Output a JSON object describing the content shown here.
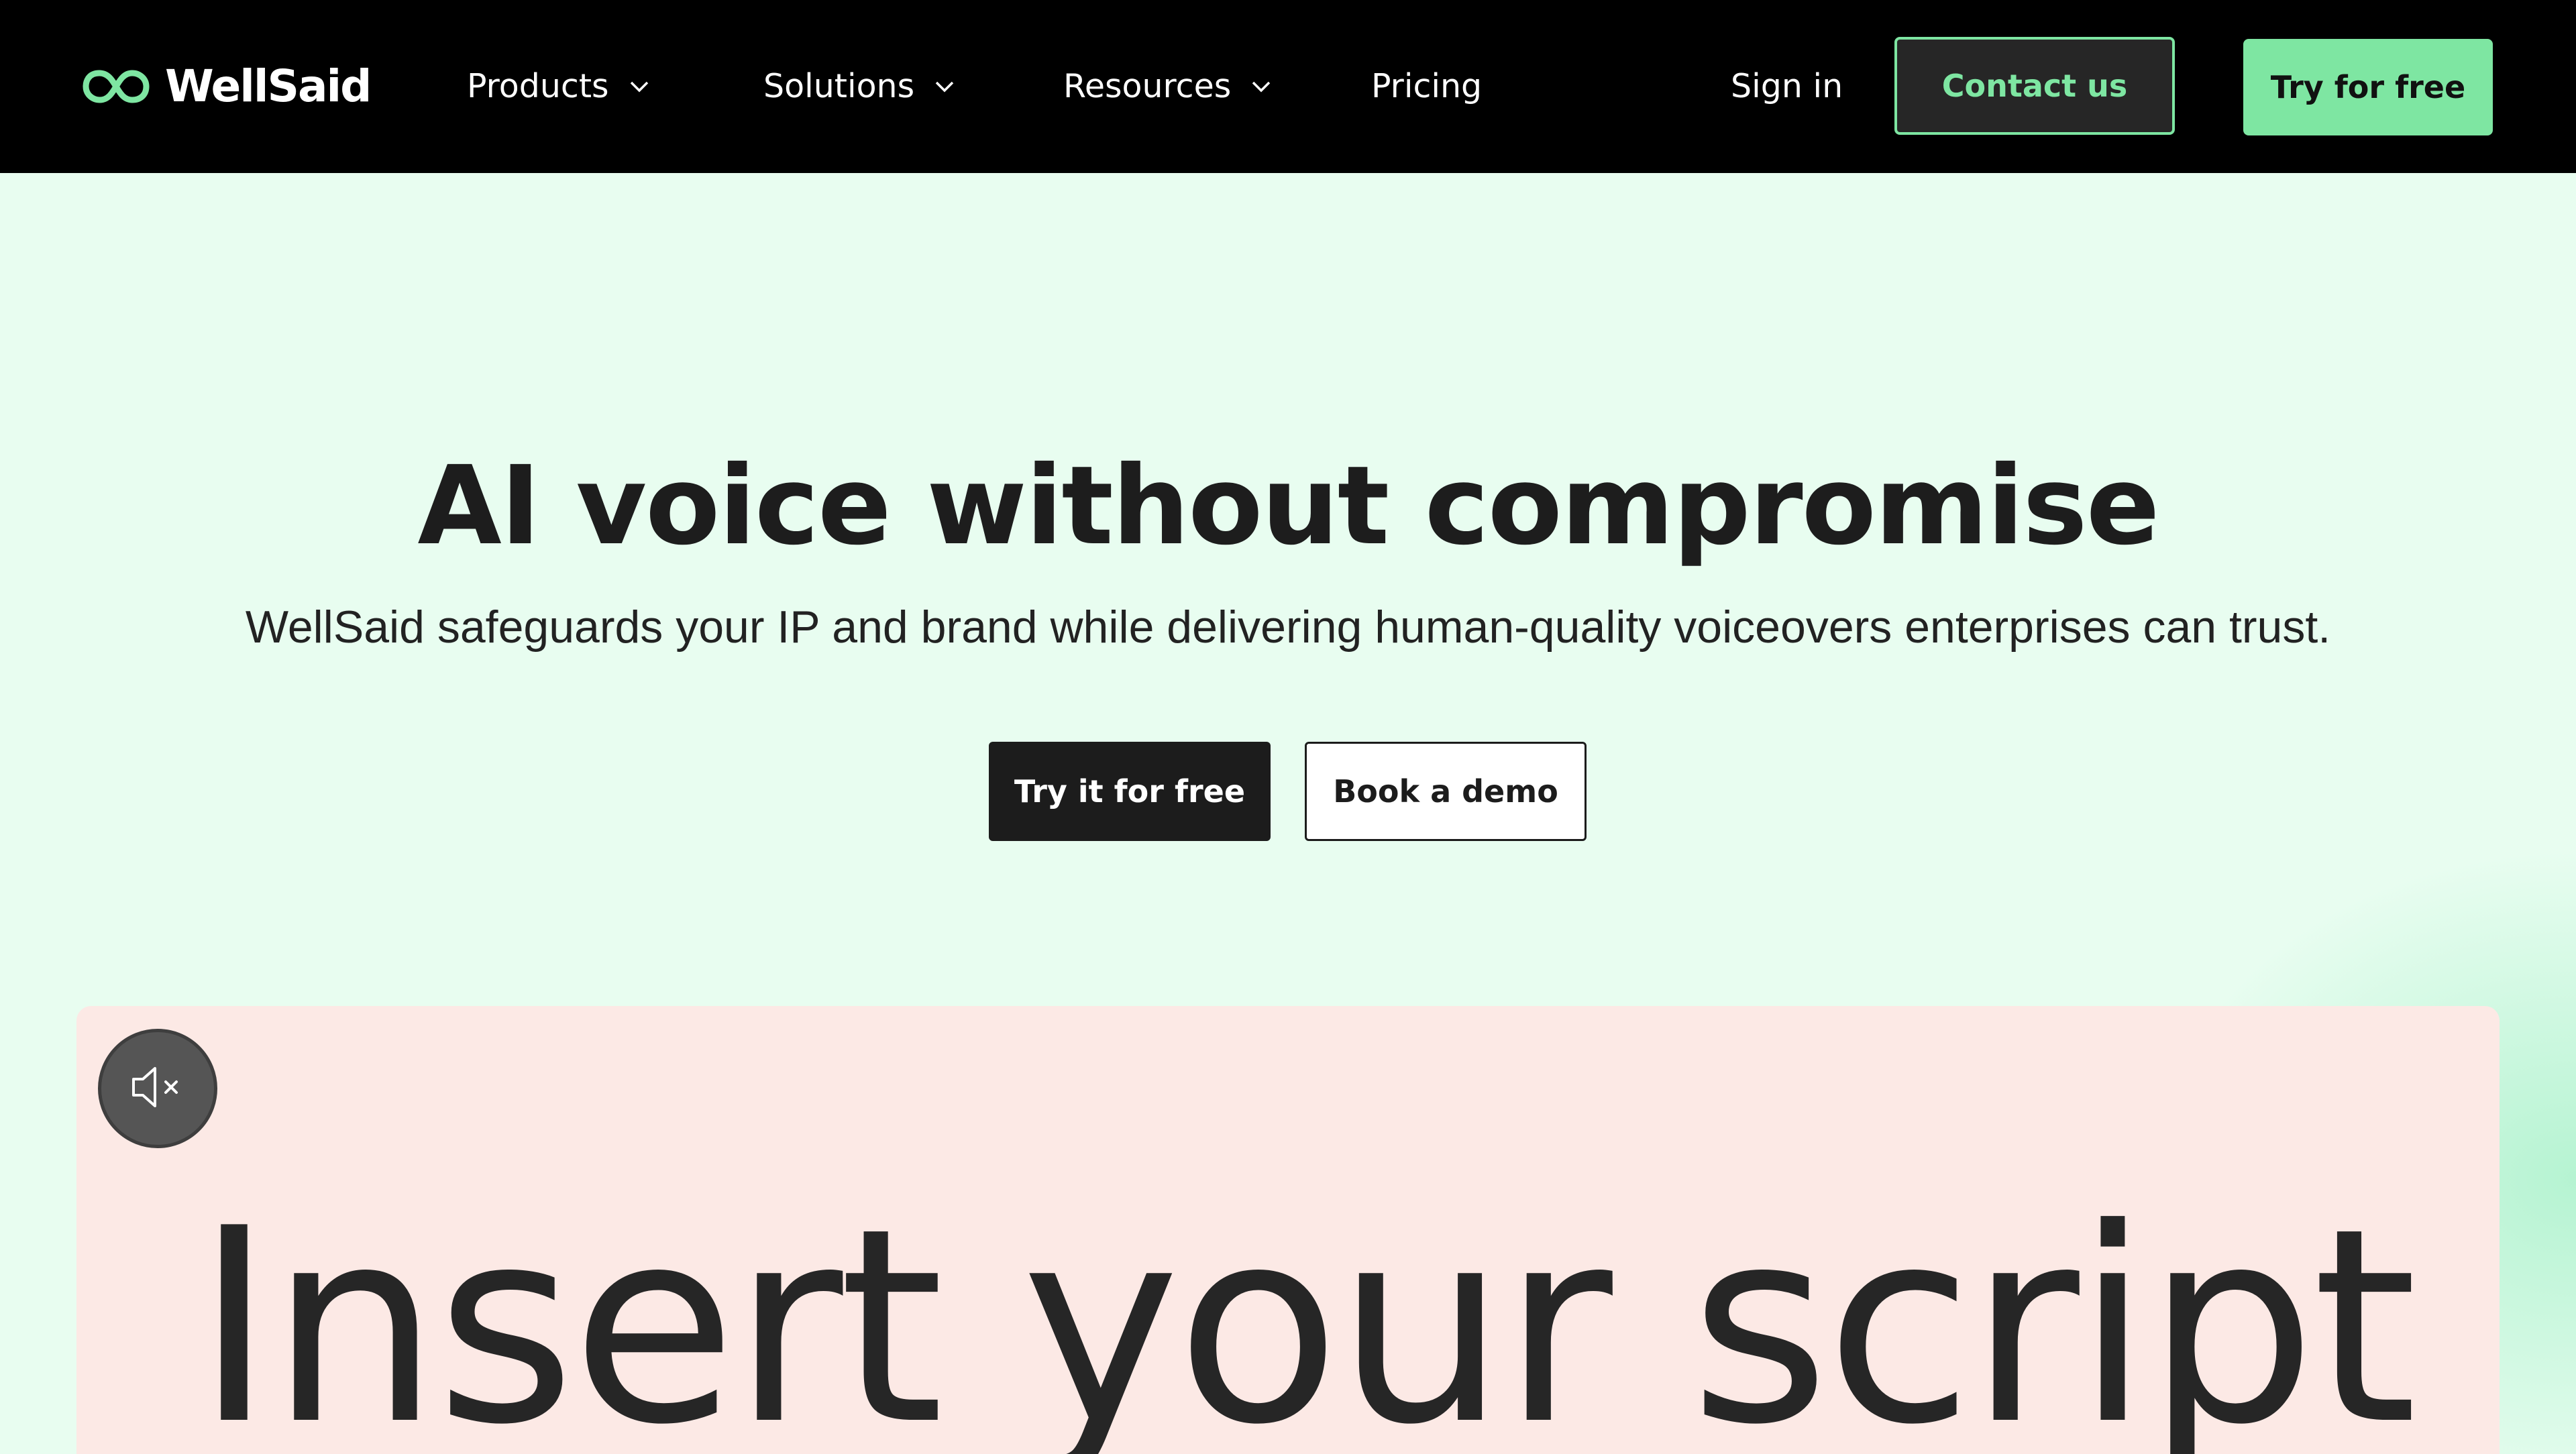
{
  "brand": {
    "name": "WellSaid",
    "logo_icon": "wellsaid-infinity-logo",
    "accent_color": "#7ee6a2"
  },
  "nav": {
    "items": [
      {
        "label": "Products",
        "has_dropdown": true
      },
      {
        "label": "Solutions",
        "has_dropdown": true
      },
      {
        "label": "Resources",
        "has_dropdown": true
      },
      {
        "label": "Pricing",
        "has_dropdown": false
      }
    ],
    "sign_in": "Sign in",
    "contact": "Contact us",
    "try_free": "Try for free"
  },
  "hero": {
    "title": "AI voice without compromise",
    "subtitle": "WellSaid safeguards your IP and brand while delivering human-quality voiceovers enterprises can trust.",
    "primary_cta": "Try it for free",
    "secondary_cta": "Book a demo"
  },
  "video": {
    "text": "Insert  your script",
    "mute_icon": "speaker-muted-icon",
    "background_color": "#fce9e5"
  }
}
